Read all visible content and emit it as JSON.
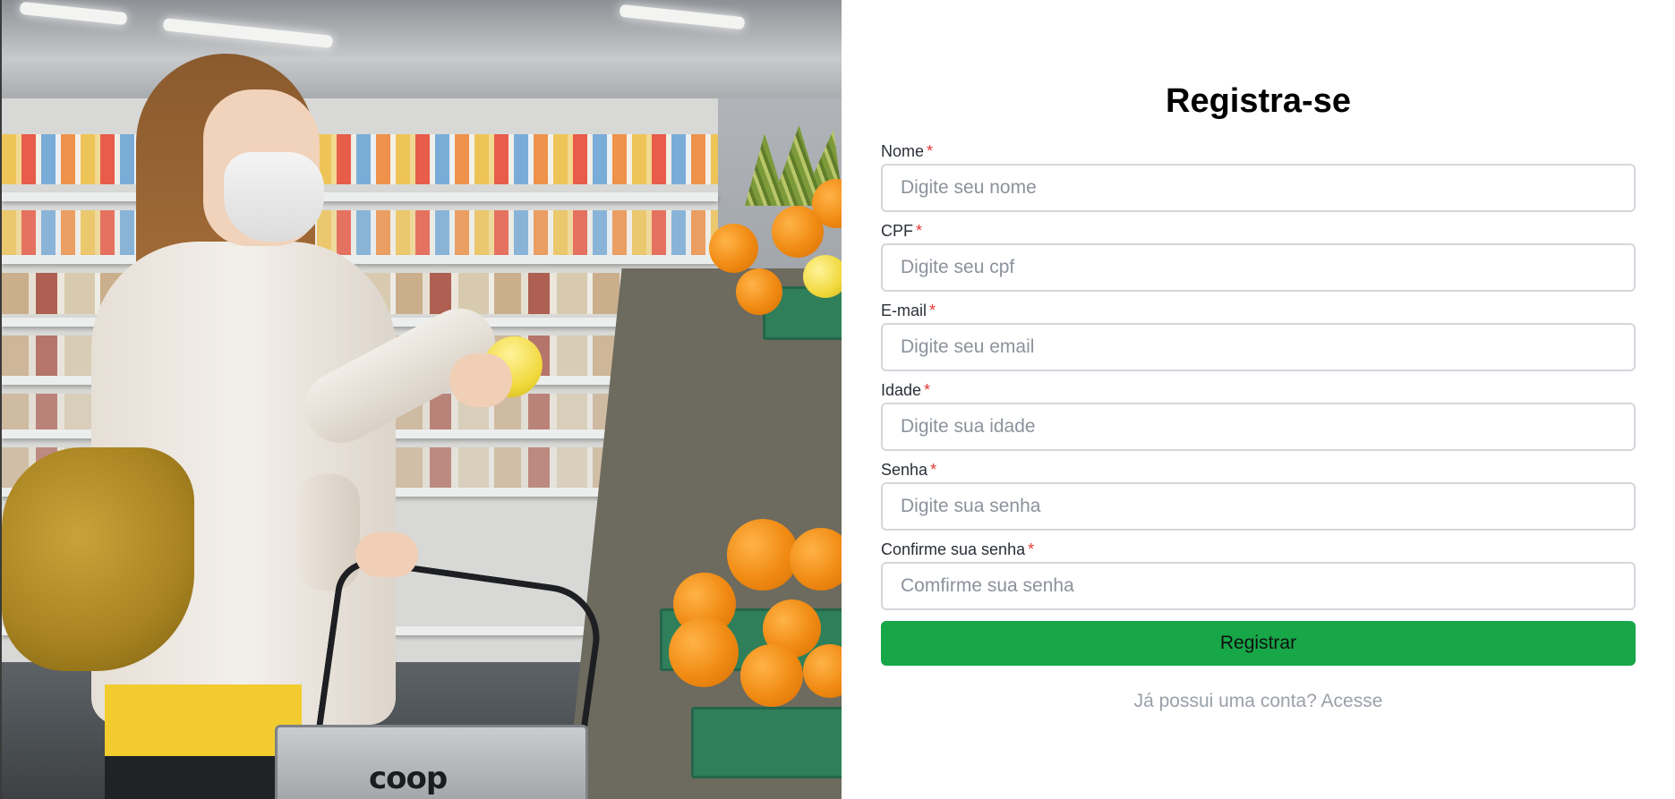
{
  "photo": {
    "alt_semantic": "woman-shopping-groceries-photo",
    "basket_brand": "coop"
  },
  "form": {
    "title": "Registra-se",
    "required_marker": "*",
    "fields": {
      "nome": {
        "label": "Nome",
        "placeholder": "Digite seu nome",
        "value": ""
      },
      "cpf": {
        "label": "CPF",
        "placeholder": "Digite seu cpf",
        "value": ""
      },
      "email": {
        "label": "E-mail",
        "placeholder": "Digite seu email",
        "value": ""
      },
      "idade": {
        "label": "Idade",
        "placeholder": "Digite sua idade",
        "value": ""
      },
      "senha": {
        "label": "Senha",
        "placeholder": "Digite sua senha",
        "value": ""
      },
      "confirm": {
        "label": "Confirme sua senha",
        "placeholder": "Comfirme sua senha",
        "value": ""
      }
    },
    "submit_label": "Registrar",
    "login_prompt": "Já possui uma conta? Acesse"
  },
  "colors": {
    "primary_button": "#17a648",
    "required_asterisk": "#e53935",
    "input_border": "#d4d7dc",
    "muted_text": "#9aa0a8"
  }
}
